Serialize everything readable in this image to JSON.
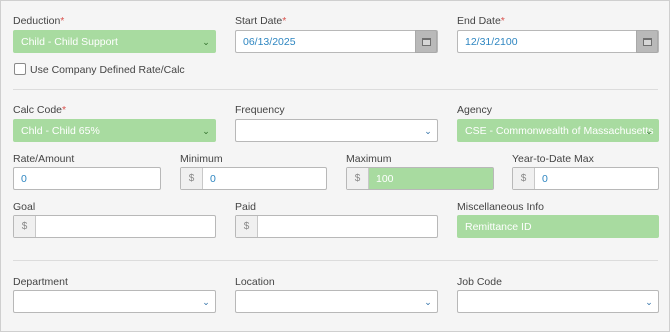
{
  "deduction": {
    "label": "Deduction",
    "required": "*",
    "value": "Child - Child Support"
  },
  "start_date": {
    "label": "Start Date",
    "required": "*",
    "value": "06/13/2025"
  },
  "end_date": {
    "label": "End Date",
    "required": "*",
    "value": "12/31/2100"
  },
  "use_company_rate": {
    "label": "Use Company Defined Rate/Calc",
    "checked": false
  },
  "calc_code": {
    "label": "Calc Code",
    "required": "*",
    "value": "Chld - Child 65%"
  },
  "frequency": {
    "label": "Frequency",
    "value": ""
  },
  "agency": {
    "label": "Agency",
    "value": "CSE - Commonwealth of Massachusetts"
  },
  "rate_amount": {
    "label": "Rate/Amount",
    "value": "0"
  },
  "minimum": {
    "label": "Minimum",
    "prefix": "$",
    "value": "0"
  },
  "maximum": {
    "label": "Maximum",
    "prefix": "$",
    "value": "100"
  },
  "ytd_max": {
    "label": "Year-to-Date Max",
    "prefix": "$",
    "value": "0"
  },
  "goal": {
    "label": "Goal",
    "prefix": "$",
    "value": ""
  },
  "paid": {
    "label": "Paid",
    "prefix": "$",
    "value": ""
  },
  "misc_info": {
    "label": "Miscellaneous Info",
    "value": "Remittance ID"
  },
  "department": {
    "label": "Department",
    "value": ""
  },
  "location": {
    "label": "Location",
    "value": ""
  },
  "job_code": {
    "label": "Job Code",
    "value": ""
  },
  "icons": {
    "dropdown": "chevron-down-icon",
    "calendar": "calendar-icon"
  },
  "colors": {
    "highlight_green": "#a8dba0",
    "required_red": "#d9534f",
    "value_blue": "#2e86c1"
  }
}
